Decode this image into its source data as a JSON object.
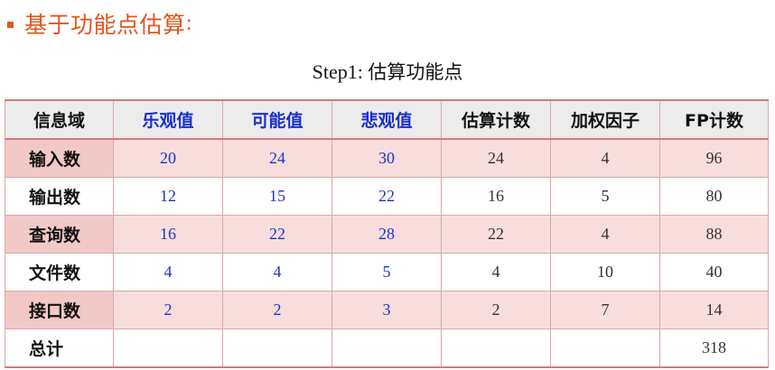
{
  "heading": {
    "title": "基于功能点估算",
    "colon": ":"
  },
  "subtitle": {
    "step": "Step1:",
    "text": "估算功能点"
  },
  "table": {
    "headers": [
      "信息域",
      "乐观值",
      "可能值",
      "悲观值",
      "估算计数",
      "加权因子",
      "FP计数"
    ],
    "rows": [
      [
        "输入数",
        "20",
        "24",
        "30",
        "24",
        "4",
        "96"
      ],
      [
        "输出数",
        "12",
        "15",
        "22",
        "16",
        "5",
        "80"
      ],
      [
        "查询数",
        "16",
        "22",
        "28",
        "22",
        "4",
        "88"
      ],
      [
        "文件数",
        "4",
        "4",
        "5",
        "4",
        "10",
        "40"
      ],
      [
        "接口数",
        "2",
        "2",
        "3",
        "2",
        "7",
        "14"
      ],
      [
        "总计",
        "",
        "",
        "",
        "",
        "",
        "318"
      ]
    ]
  },
  "colors": {
    "accent": "#e2561d",
    "blue_text": "#1b2fd0",
    "pink_row": "#f7dedd",
    "header_bg": "#ececec"
  }
}
